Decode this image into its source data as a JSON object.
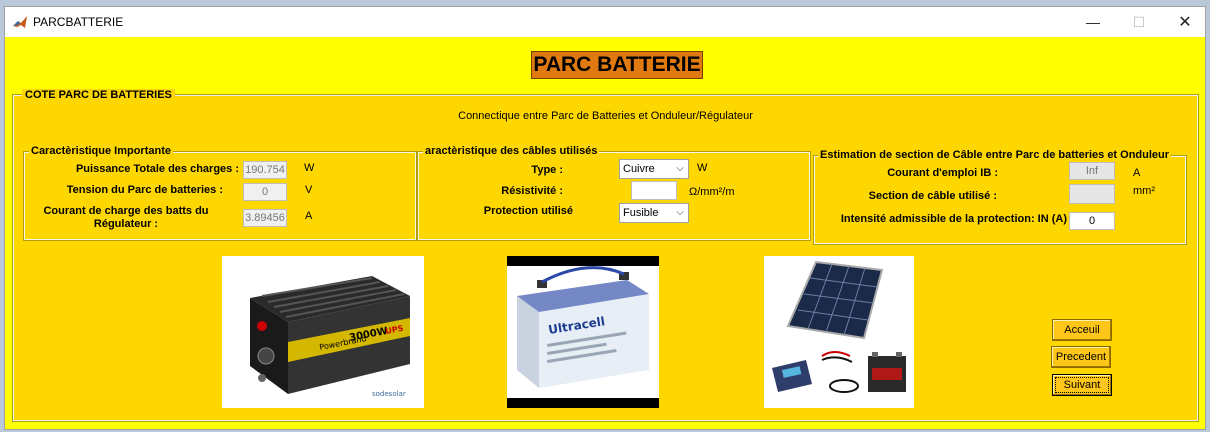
{
  "window": {
    "title": "PARCBATTERIE"
  },
  "header": {
    "title": "PARC BATTERIE"
  },
  "panel": {
    "title": "COTE PARC DE BATTERIES",
    "subtitle": "Connectique entre Parc de Batteries et Onduleur/Régulateur"
  },
  "groups": {
    "carac": {
      "title": "Caractèristique Importante",
      "puissance_label": "Puissance Totale des charges :",
      "puissance_value": "190.754",
      "puissance_unit": "W",
      "tension_label": "Tension du Parc de batteries :",
      "tension_value": "0",
      "tension_unit": "V",
      "courant_label_1": "Courant de charge des batts du",
      "courant_label_2": "Régulateur :",
      "courant_value": "3.89456",
      "courant_unit": "A"
    },
    "cables": {
      "title": "aractèristique des câbles utilisés",
      "type_label": "Type :",
      "type_value": "Cuivre",
      "type_unit": "W",
      "resistivite_label": "Résistivité :",
      "resistivite_value": "",
      "resistivite_unit": "Ω/mm²/m",
      "protection_label": "Protection utilisé",
      "protection_value": "Fusible"
    },
    "section": {
      "title": "Estimation de section de Câble entre Parc de batteries et Onduleur",
      "courant_label": "Courant d'emploi IB :",
      "courant_value": "Inf",
      "courant_unit": "A",
      "section_label": "Section de câble utilisé :",
      "section_value": "",
      "section_unit": "mm²",
      "intensite_label": "Intensité admissible de la protection: IN (A)",
      "intensite_value": "0"
    }
  },
  "images": {
    "inverter_brand": "Powerbrand",
    "inverter_model": "3000W",
    "inverter_tag": "UPS",
    "inverter_credit": "sodesolar",
    "battery_brand": "Ultracell"
  },
  "nav": {
    "accueil": "Acceuil",
    "precedent": "Precedent",
    "suivant": "Suivant"
  }
}
